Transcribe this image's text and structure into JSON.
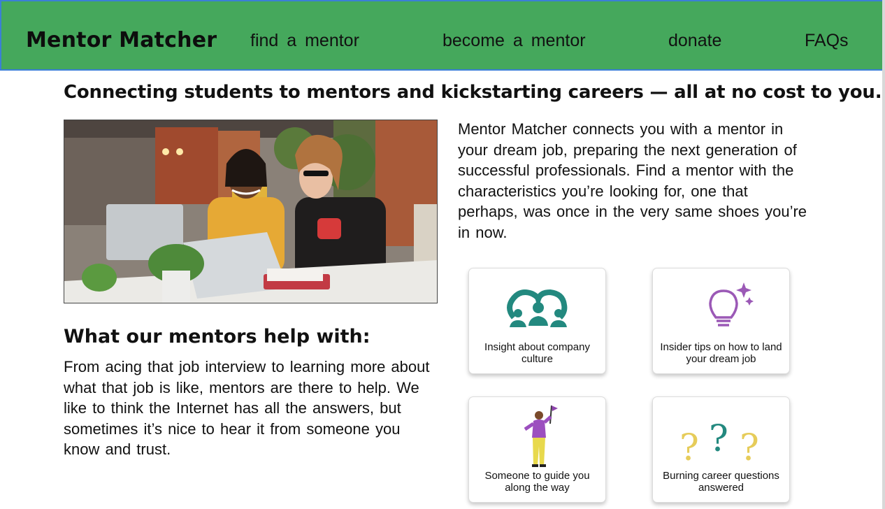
{
  "header": {
    "brand": "Mentor Matcher",
    "links": [
      "find  a  mentor",
      "become  a  mentor",
      "donate",
      "FAQs"
    ],
    "background_color": "#45a85c",
    "border_color": "#3b7fd6"
  },
  "tagline": "Connecting students to mentors and kickstarting careers — all at no cost to you.",
  "photo": {
    "icon": "mentoring-photo"
  },
  "intro": "Mentor Matcher connects you with a mentor in your dream job, preparing the next generation of successful professionals. Find a mentor with the characteristics you’re looking for, one that perhaps, was once in the very same shoes you’re in now.",
  "help": {
    "title": "What our mentors help with:",
    "text": "From acing that job interview to learning more about what that job is like, mentors are there to help. We like to think the Internet has all the answers, but sometimes it’s nice to hear it from someone you know and trust."
  },
  "cards": [
    {
      "label": "Insight about company culture",
      "icon": "group-icon",
      "color": "#23897f"
    },
    {
      "label": "Insider tips on how to land your dream job",
      "icon": "lightbulb-icon",
      "color": "#9b59b6"
    },
    {
      "label": "Someone to guide you along the way",
      "icon": "guide-person-icon",
      "color": "#8e44ad"
    },
    {
      "label": "Burning career questions answered",
      "icon": "question-marks-icon",
      "color": "#e6cc5a"
    }
  ]
}
